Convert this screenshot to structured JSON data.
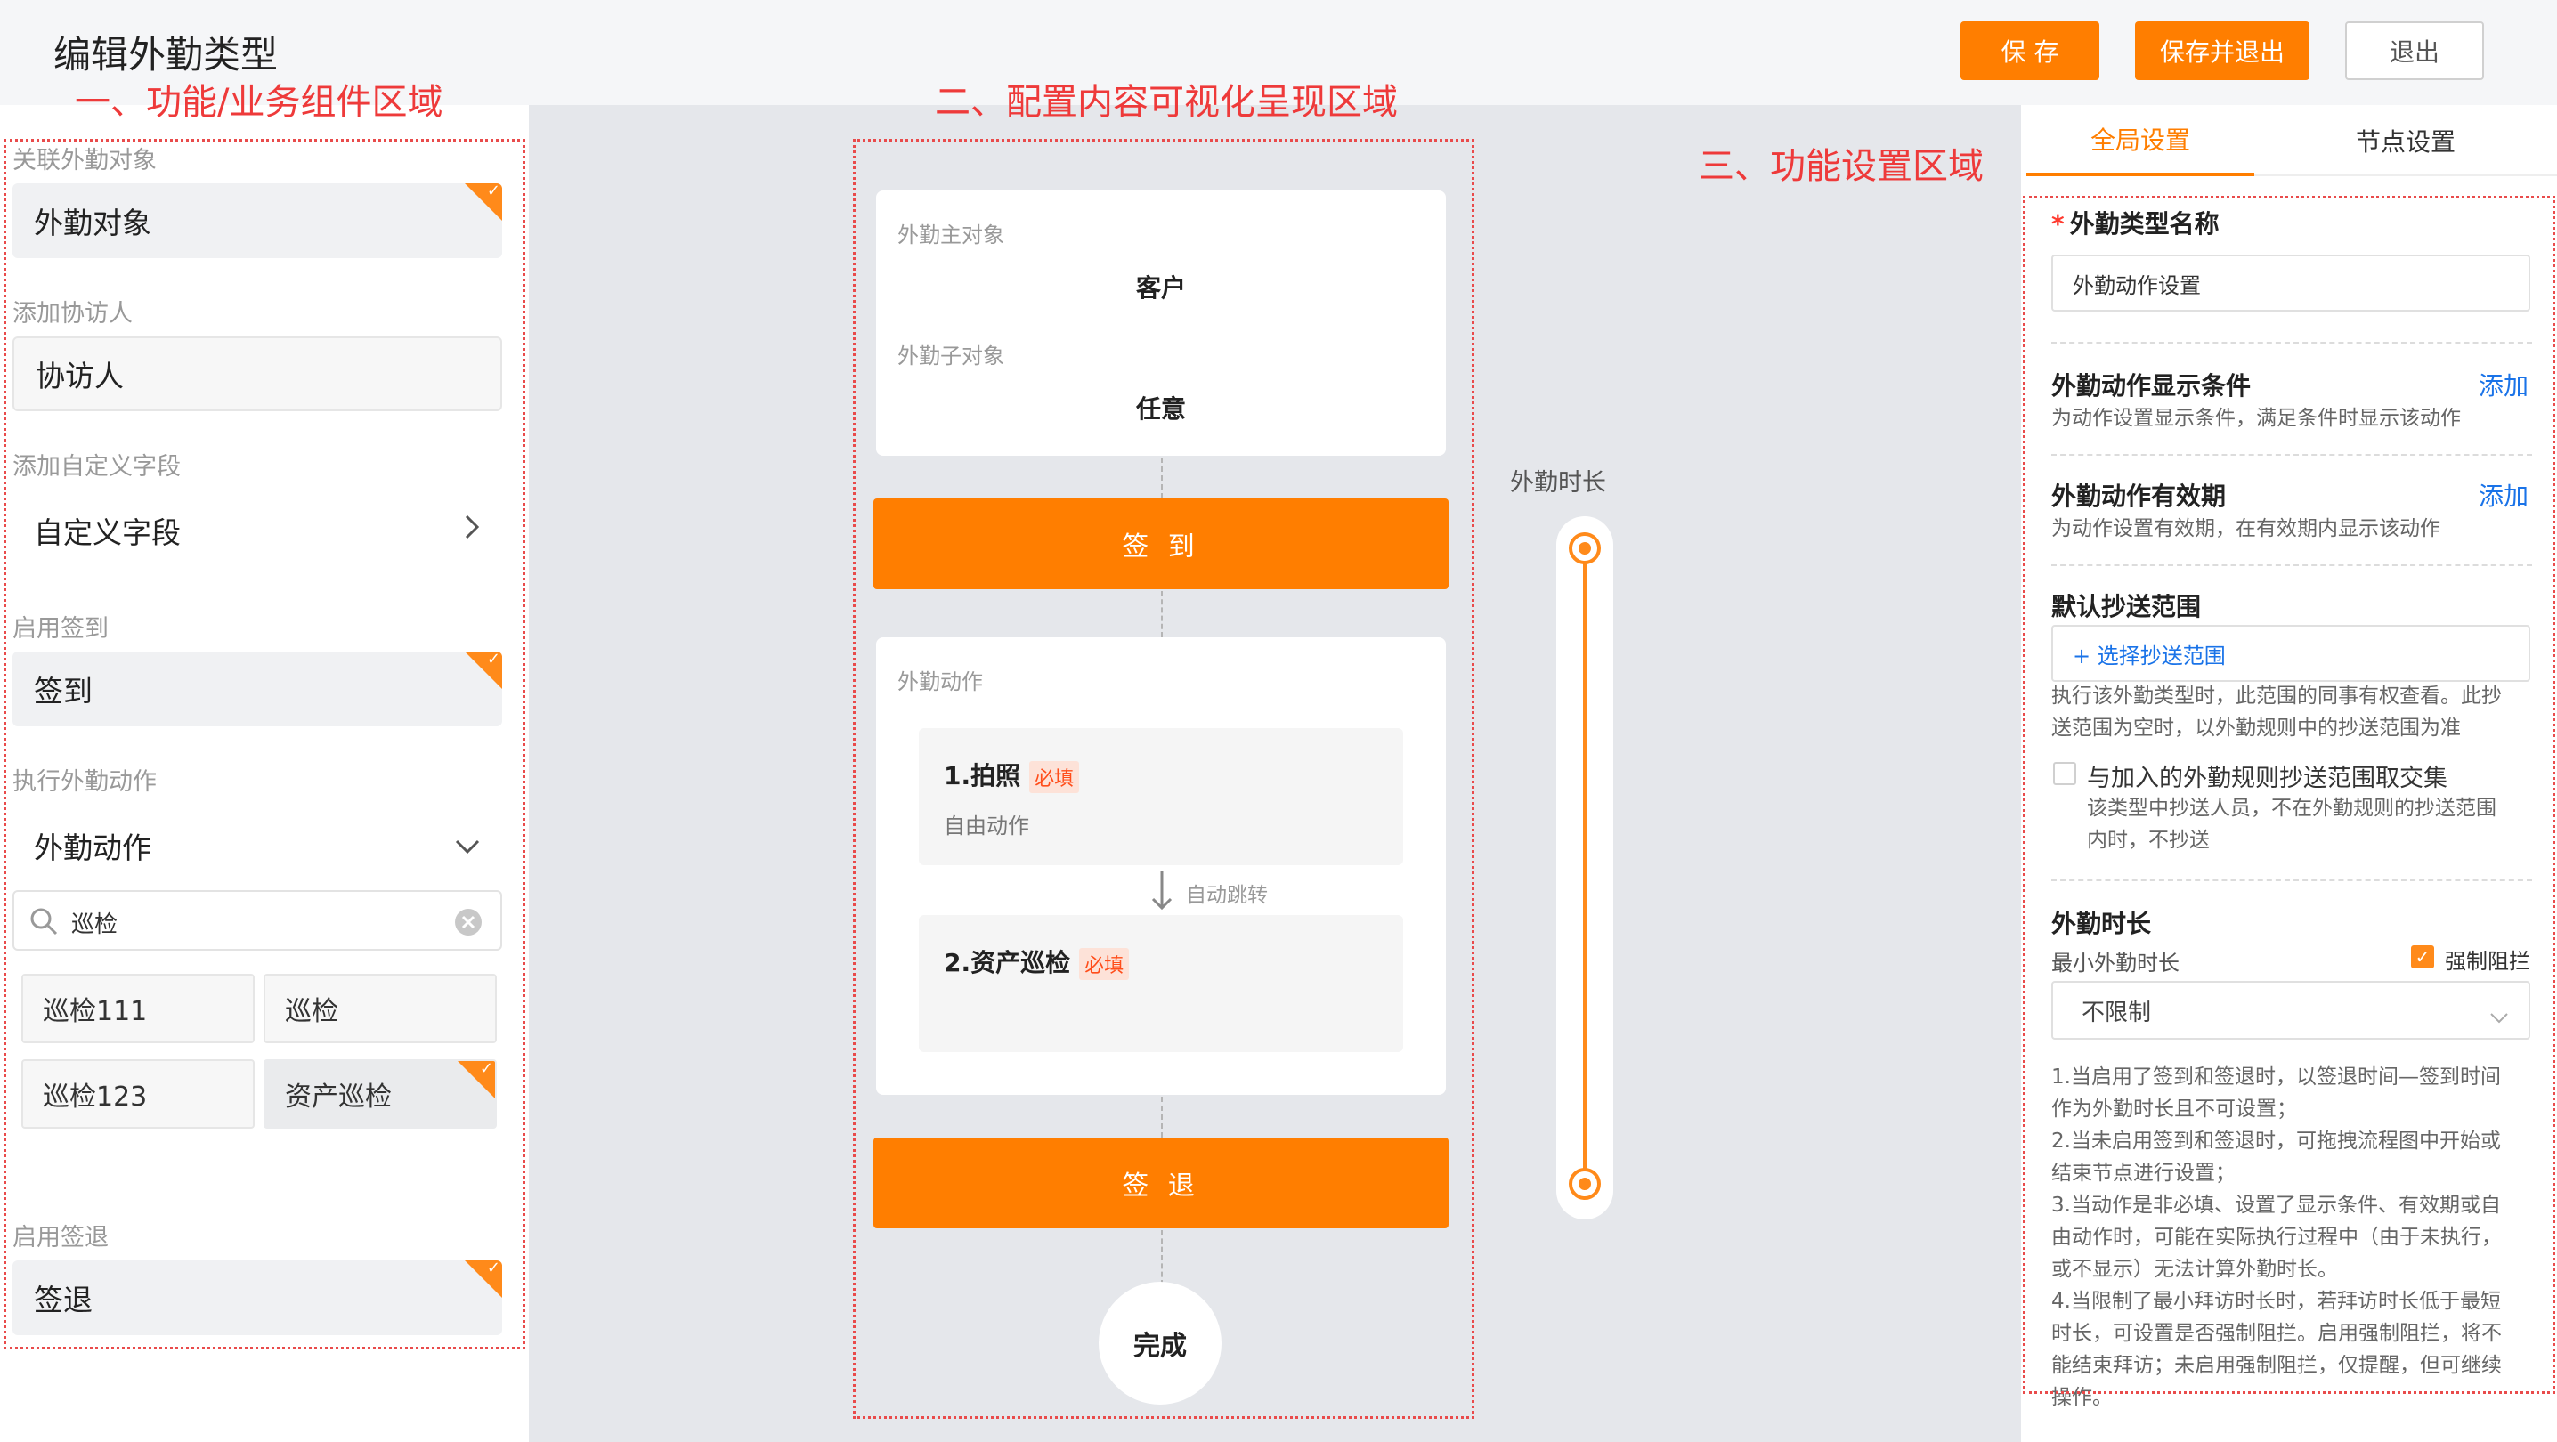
{
  "header": {
    "title": "编辑外勤类型",
    "save": "保 存",
    "save_exit": "保存并退出",
    "exit": "退出"
  },
  "annotations": {
    "zone1": "一、功能/业务组件区域",
    "zone2": "二、配置内容可视化呈现区域",
    "zone3": "三、功能设置区域"
  },
  "left": {
    "object_label": "关联外勤对象",
    "object_value": "外勤对象",
    "companion_label": "添加协访人",
    "companion_value": "协访人",
    "custom_label": "添加自定义字段",
    "custom_value": "自定义字段",
    "checkin_label": "启用签到",
    "checkin_value": "签到",
    "action_label": "执行外勤动作",
    "action_value": "外勤动作",
    "search_value": "巡检",
    "chips": [
      "巡检111",
      "巡检",
      "巡检123",
      "资产巡检"
    ],
    "checkout_label": "启用签退",
    "checkout_value": "签退"
  },
  "canvas": {
    "main_object_label": "外勤主对象",
    "main_object_value": "客户",
    "sub_object_label": "外勤子对象",
    "sub_object_value": "任意",
    "checkin": "签 到",
    "actions_label": "外勤动作",
    "action1_title": "1.拍照",
    "action1_sub": "自由动作",
    "action2_title": "2.资产巡检",
    "required": "必填",
    "auto_jump": "自动跳转",
    "checkout": "签 退",
    "done": "完成",
    "duration_label": "外勤时长"
  },
  "right": {
    "tab_global": "全局设置",
    "tab_node": "节点设置",
    "name_label": "外勤类型名称",
    "name_value": "外勤动作设置",
    "cond_title": "外勤动作显示条件",
    "cond_desc": "为动作设置显示条件，满足条件时显示该动作",
    "add": "添加",
    "valid_title": "外勤动作有效期",
    "valid_desc": "为动作设置有效期，在有效期内显示该动作",
    "cc_title": "默认抄送范围",
    "cc_button": "+ 选择抄送范围",
    "cc_desc1": "执行该外勤类型时，此范围的同事有权查看。此抄",
    "cc_desc2": "送范围为空时，以外勤规则中的抄送范围为准",
    "intersect_label": "与加入的外勤规则抄送范围取交集",
    "intersect_desc1": "该类型中抄送人员，不在外勤规则的抄送范围",
    "intersect_desc2": "内时，不抄送",
    "dur_title": "外勤时长",
    "min_dur_label": "最小外勤时长",
    "force_block": "强制阻拦",
    "select_value": "不限制",
    "notes": [
      "1.当启用了签到和签退时，以签退时间—签到时间",
      "作为外勤时长且不可设置；",
      "2.当未启用签到和签退时，可拖拽流程图中开始或",
      "结束节点进行设置；",
      "3.当动作是非必填、设置了显示条件、有效期或自",
      "由动作时，可能在实际执行过程中（由于未执行，",
      "或不显示）无法计算外勤时长。",
      "4.当限制了最小拜访时长时，若拜访时长低于最短",
      "时长，可设置是否强制阻拦。启用强制阻拦，将不",
      "能结束拜访；未启用强制阻拦，仅提醒，但可继续",
      "操作。"
    ]
  }
}
